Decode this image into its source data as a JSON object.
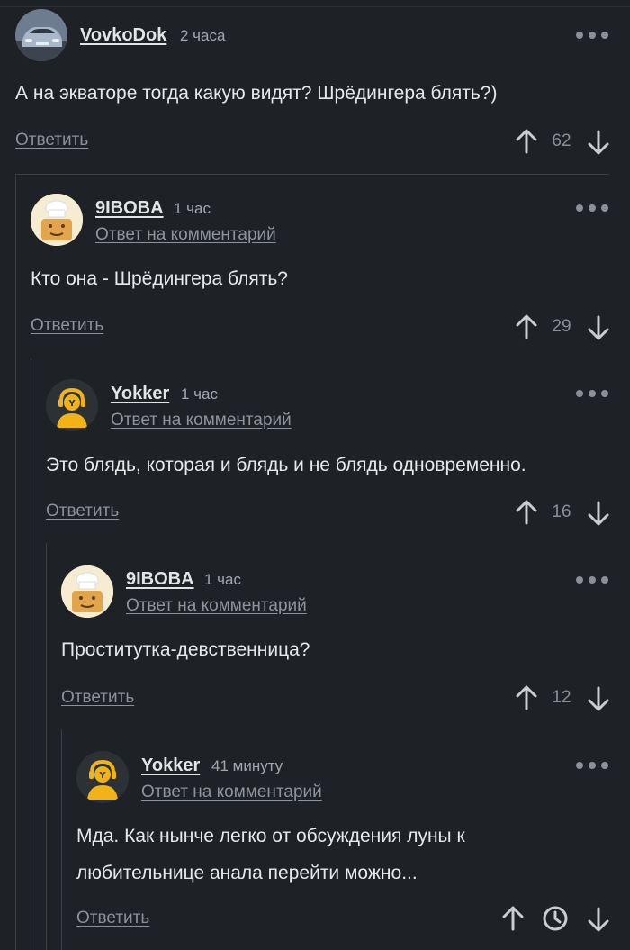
{
  "comments": [
    {
      "author": "VovkoDok",
      "time": "2 часа",
      "reply_to": "",
      "text": "А на экваторе тогда какую видят? Шрёдингера блять?)",
      "reply_label": "Ответить",
      "score": "62",
      "avatar": "car-avatar"
    },
    {
      "author": "9IBOBA",
      "time": "1 час",
      "reply_to": "Ответ на комментарий",
      "text": "Кто она - Шрёдингера блять?",
      "reply_label": "Ответить",
      "score": "29",
      "avatar": "chef-bread-avatar"
    },
    {
      "author": "Yokker",
      "time": "1 час",
      "reply_to": "Ответ на комментарий",
      "text": "Это блядь, которая и блядь и не блядь одновременно.",
      "reply_label": "Ответить",
      "score": "16",
      "avatar": "yellow-user-avatar"
    },
    {
      "author": "9IBOBA",
      "time": "1 час",
      "reply_to": "Ответ на комментарий",
      "text": "Проститутка-девственница?",
      "reply_label": "Ответить",
      "score": "12",
      "avatar": "chef-bread-avatar"
    },
    {
      "author": "Yokker",
      "time": "41 минуту",
      "reply_to": "Ответ на комментарий",
      "text_line1": "Мда. Как нынче легко от обсуждения луны к",
      "text_line2": "любительнице анала перейти можно...",
      "reply_label": "Ответить",
      "score": "",
      "avatar": "yellow-user-avatar"
    }
  ],
  "colors": {
    "background": "#1e2125",
    "text": "#e7e8ea",
    "muted": "#8d9197",
    "accent_yellow": "#f2b316"
  },
  "icons": {
    "upvote": "arrow-up-icon",
    "downvote": "arrow-down-icon",
    "more": "more-dots-icon",
    "pending": "clock-icon"
  }
}
